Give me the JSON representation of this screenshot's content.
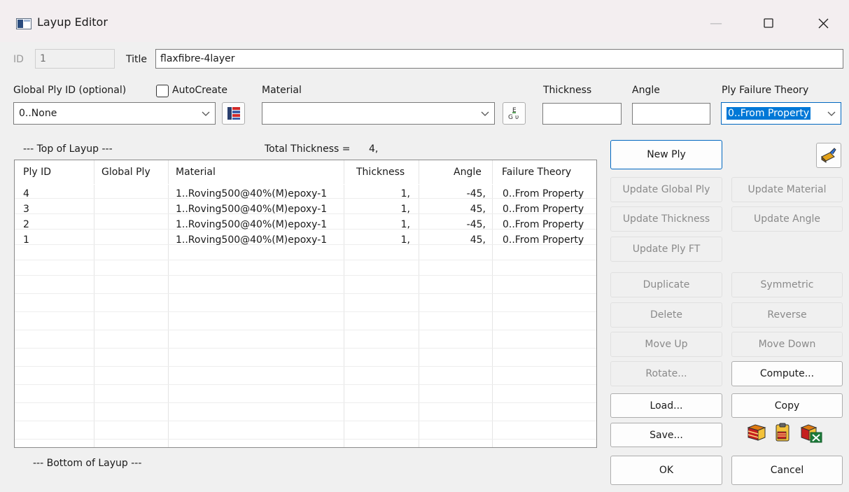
{
  "window": {
    "title": "Layup Editor",
    "min_glyph": "—",
    "max_glyph": "☐",
    "close_glyph": "✕"
  },
  "id": {
    "label": "ID",
    "value": "1"
  },
  "title_field": {
    "label": "Title",
    "value": "flaxfibre-4layer"
  },
  "global_ply": {
    "label": "Global Ply ID (optional)",
    "value": "0..None"
  },
  "autocreate": {
    "label": "AutoCreate",
    "checked": false
  },
  "material": {
    "label": "Material",
    "value": ""
  },
  "thickness": {
    "label": "Thickness",
    "value": ""
  },
  "angle": {
    "label": "Angle",
    "value": ""
  },
  "ply_failure": {
    "label": "Ply Failure Theory",
    "value": "0..From Property"
  },
  "layup": {
    "top_label": "--- Top of Layup ---",
    "bottom_label": "--- Bottom of Layup ---",
    "total_thickness_label": "Total Thickness  =",
    "total_thickness_value": "4,"
  },
  "table": {
    "columns": [
      "Ply ID",
      "Global Ply",
      "Material",
      "Thickness",
      "Angle",
      "Failure Theory"
    ],
    "rows": [
      [
        "4",
        "",
        "1..Roving500@40%(M)epoxy-1",
        "1,",
        "-45,",
        "0..From Property"
      ],
      [
        "3",
        "",
        "1..Roving500@40%(M)epoxy-1",
        "1,",
        "45,",
        "0..From Property"
      ],
      [
        "2",
        "",
        "1..Roving500@40%(M)epoxy-1",
        "1,",
        "-45,",
        "0..From Property"
      ],
      [
        "1",
        "",
        "1..Roving500@40%(M)epoxy-1",
        "1,",
        "45,",
        "0..From Property"
      ]
    ]
  },
  "buttons": {
    "new_ply": "New Ply",
    "update_global_ply": "Update Global Ply",
    "update_material": "Update Material",
    "update_thickness": "Update Thickness",
    "update_angle": "Update Angle",
    "update_ply_ft": "Update Ply FT",
    "duplicate": "Duplicate",
    "symmetric": "Symmetric",
    "delete": "Delete",
    "reverse": "Reverse",
    "move_up": "Move Up",
    "move_down": "Move Down",
    "rotate": "Rotate...",
    "compute": "Compute...",
    "load": "Load...",
    "copy": "Copy",
    "save": "Save...",
    "ok": "OK",
    "cancel": "Cancel"
  },
  "icons": {
    "app": "layup-app-icon",
    "global_ply_picker": "layer-list-icon",
    "material_picker": "material-EGv-icon",
    "new_ply_edit": "paint-brush-icon",
    "layers": "layers-icon",
    "clipboard": "clipboard-icon",
    "excel": "excel-export-icon",
    "material_glyph_top": "E",
    "material_glyph_bottom": "G",
    "material_glyph_side": "υ"
  },
  "colors": {
    "accent": "#0067c0",
    "selection": "#0078d7",
    "disabled_text": "#8a8a8a"
  }
}
